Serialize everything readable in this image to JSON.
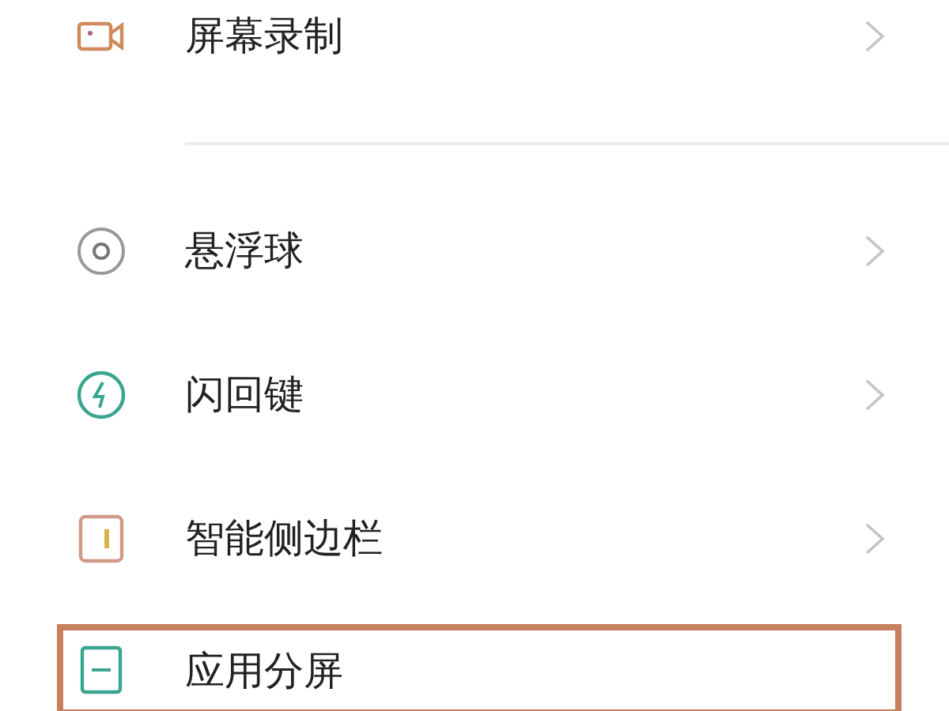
{
  "settings_items": [
    {
      "label": "屏幕录制",
      "kind": "camera",
      "chevron": true,
      "highlighted": false,
      "divider_after": true
    },
    {
      "label": "悬浮球",
      "kind": "ball",
      "chevron": true,
      "highlighted": false,
      "divider_after": false
    },
    {
      "label": "闪回键",
      "kind": "bolt",
      "chevron": true,
      "highlighted": false,
      "divider_after": false
    },
    {
      "label": "智能侧边栏",
      "kind": "sidebar",
      "chevron": true,
      "highlighted": false,
      "divider_after": false
    },
    {
      "label": "应用分屏",
      "kind": "split",
      "chevron": false,
      "highlighted": true,
      "divider_after": false
    }
  ]
}
